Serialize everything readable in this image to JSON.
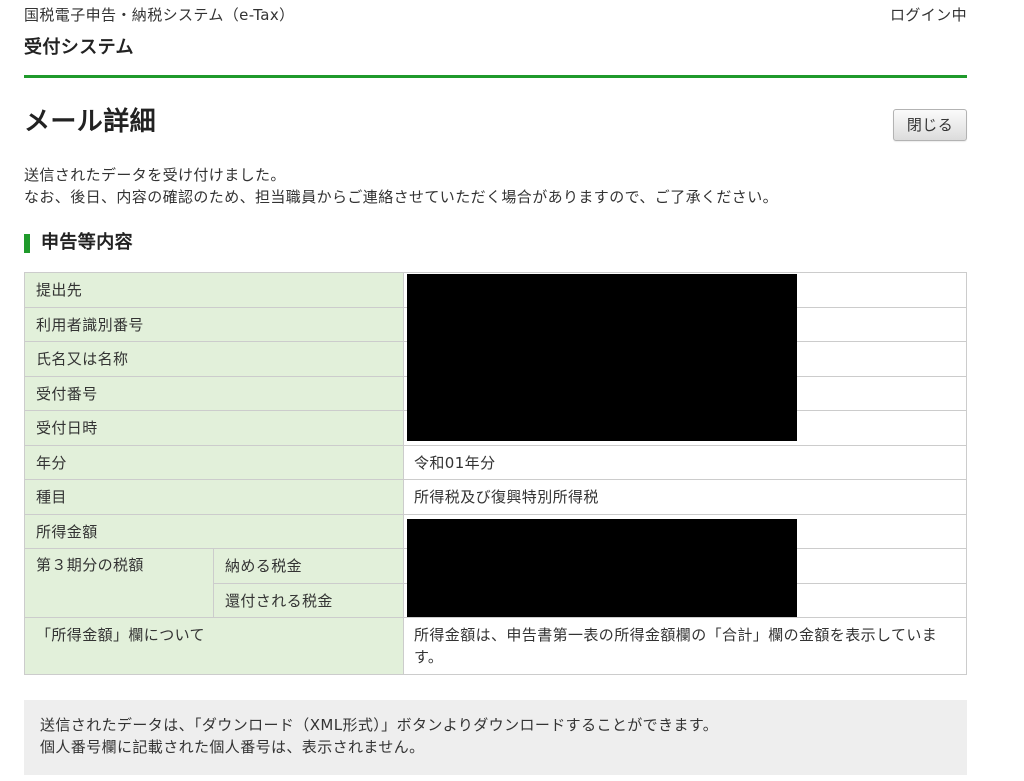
{
  "header": {
    "system_name": "国税電子申告・納税システム（e-Tax）",
    "login_status": "ログイン中",
    "subsystem_title": "受付システム"
  },
  "page": {
    "title": "メール詳細",
    "close_button_label": "閉じる",
    "messages": [
      "送信されたデータを受け付けました。",
      "なお、後日、内容の確認のため、担当職員からご連絡させていただく場合がありますので、ご了承ください。"
    ]
  },
  "details": {
    "section_title": "申告等内容",
    "rows": [
      {
        "label": "提出先",
        "value_redacted": true
      },
      {
        "label": "利用者識別番号",
        "value_redacted": true
      },
      {
        "label": "氏名又は名称",
        "value_redacted": true
      },
      {
        "label": "受付番号",
        "value_redacted": true
      },
      {
        "label": "受付日時",
        "value_redacted": true
      },
      {
        "label": "年分",
        "value": "令和01年分"
      },
      {
        "label": "種目",
        "value": "所得税及び復興特別所得税"
      },
      {
        "label": "所得金額",
        "value_redacted": true
      }
    ],
    "third_period_tax": {
      "label": "第３期分の税額",
      "items": [
        {
          "label": "納める税金",
          "value_redacted": true
        },
        {
          "label": "還付される税金",
          "value_redacted": true
        }
      ]
    },
    "income_note": {
      "label": "「所得金額」欄について",
      "value": "所得金額は、申告書第一表の所得金額欄の「合計」欄の金額を表示しています。"
    }
  },
  "notice": {
    "lines": [
      "送信されたデータは、「ダウンロード（XML形式）」ボタンよりダウンロードすることができます。",
      "個人番号欄に記載された個人番号は、表示されません。"
    ]
  },
  "colors": {
    "accent_green": "#1f9a2b",
    "label_background": "#e2f0da",
    "table_border": "#cccccc",
    "notice_background": "#eeeeee",
    "redaction": "#000000"
  }
}
